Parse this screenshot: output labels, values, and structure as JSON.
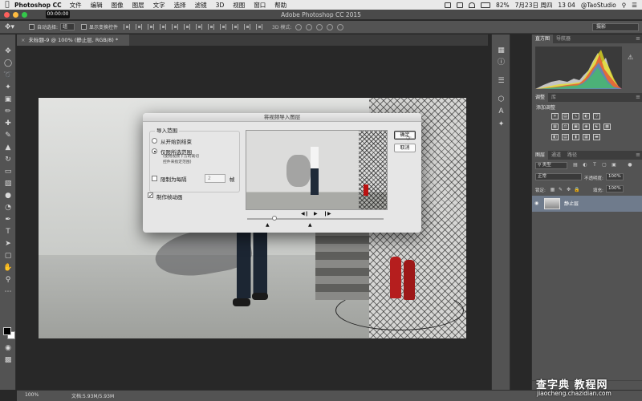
{
  "menubar": {
    "app_name": "Photoshop CC",
    "items": [
      "文件",
      "编辑",
      "图像",
      "图层",
      "文字",
      "选择",
      "滤镜",
      "3D",
      "视图",
      "窗口",
      "帮助"
    ],
    "battery": "82%",
    "date": "7月23日 周四",
    "time": "13 04",
    "user": "@TaoStudio"
  },
  "titlebar": {
    "timecode": "00:00:00",
    "title": "Adobe Photoshop CC 2015"
  },
  "options_bar": {
    "auto_select_label": "自动选择:",
    "auto_select_value": "组",
    "show_transform_label": "显示变换控件",
    "mode_3d_label": "3D 模式:",
    "workspace": "摄影"
  },
  "document": {
    "tab_title": "未标题-9 @ 100% (静止层, RGB/8) *"
  },
  "panels": {
    "histogram_tabs": [
      "直方图",
      "导航器"
    ],
    "adjust_tabs": [
      "调整",
      "库"
    ],
    "adjust_title": "添加调整",
    "layers_tabs": [
      "图层",
      "通道",
      "路径"
    ],
    "layer_kind": "类型",
    "blend_mode": "正常",
    "opacity_label": "不透明度:",
    "opacity_value": "100%",
    "lock_label": "锁定:",
    "fill_label": "填充:",
    "fill_value": "100%",
    "layer_name": "静止层"
  },
  "status": {
    "zoom": "100%",
    "doc_size": "文档:5.93M/5.93M"
  },
  "dialog": {
    "title": "将视频导入图层",
    "group_label": "导入范围",
    "option_full": "从开始到结束",
    "option_range": "仅限所选范围",
    "option_range_note_1": "(使用视频下方的裁切",
    "option_range_note_2": "控件来指定范围)",
    "limit_label": "限制为每隔",
    "limit_value": "2",
    "limit_unit": "帧",
    "make_animation_label": "制作帧动画",
    "ok_label": "确定",
    "cancel_label": "取消",
    "selected_option": "option_range"
  },
  "watermark": {
    "main": "查字典 教程网",
    "url": "jiaocheng.chazidian.com"
  }
}
